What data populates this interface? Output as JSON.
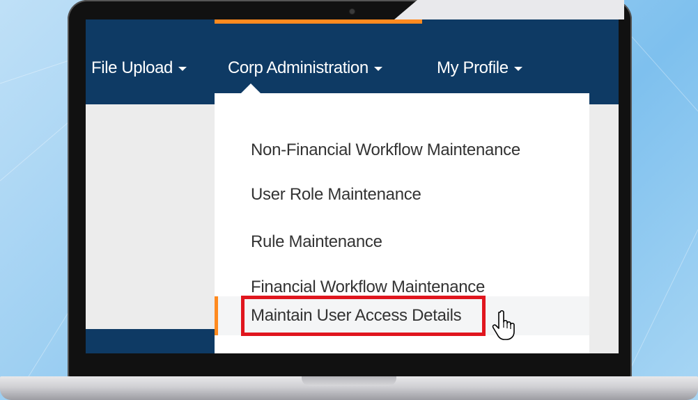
{
  "nav": {
    "items": [
      {
        "label": "File Upload"
      },
      {
        "label": "Corp Administration"
      },
      {
        "label": "My Profile"
      }
    ]
  },
  "menu": {
    "items": [
      {
        "label": "Non-Financial Workflow Maintenance"
      },
      {
        "label": "User Role Maintenance"
      },
      {
        "label": "Rule Maintenance"
      },
      {
        "label": "Financial Workflow Maintenance"
      },
      {
        "label": "Maintain User Access Details"
      }
    ],
    "selected_index": 4
  },
  "colors": {
    "topbar": "#0e3a64",
    "accent": "#ff8a1f",
    "highlight_border": "#e0161e",
    "menu_text": "#333333"
  },
  "icons": {
    "cursor": "hand-pointer-icon",
    "caret": "caret-down-icon",
    "camera": "webcam-icon"
  }
}
